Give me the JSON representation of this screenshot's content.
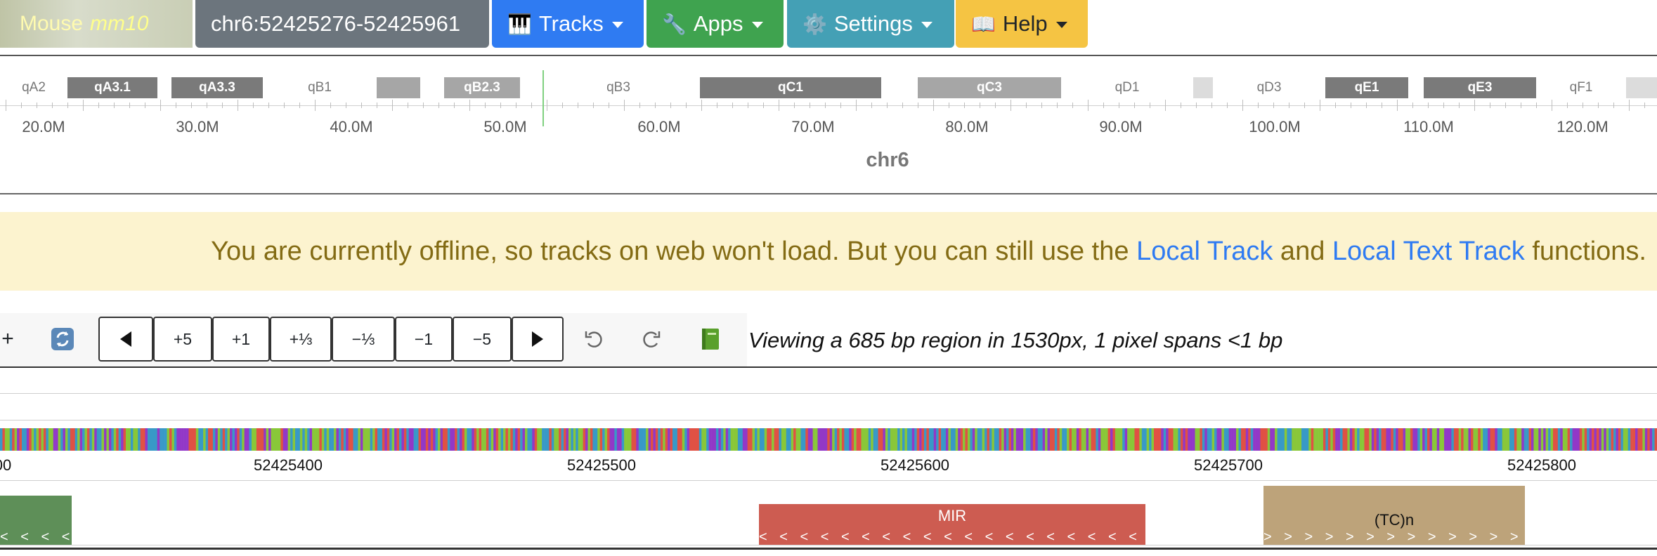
{
  "navbar": {
    "species": "Mouse",
    "assembly": "mm10",
    "region": "chr6:52425276-52425961",
    "tracks": "Tracks",
    "apps": "Apps",
    "settings": "Settings",
    "help": "Help",
    "tracks_icon": "🎹",
    "apps_icon": "🔧",
    "settings_icon": "⚙️",
    "help_icon": "📖"
  },
  "ideogram": {
    "chromosome": "chr6",
    "bands": [
      {
        "name": "qA2",
        "stain": "white"
      },
      {
        "name": "qA3.1",
        "stain": "dark"
      },
      {
        "name": "",
        "stain": "white"
      },
      {
        "name": "qA3.3",
        "stain": "dark"
      },
      {
        "name": "qB1",
        "stain": "white"
      },
      {
        "name": "",
        "stain": "mid"
      },
      {
        "name": "",
        "stain": "white"
      },
      {
        "name": "qB2.3",
        "stain": "mid"
      },
      {
        "name": "",
        "stain": "white"
      },
      {
        "name": "qB3",
        "stain": "white"
      },
      {
        "name": "qC1",
        "stain": "dark"
      },
      {
        "name": "",
        "stain": "white"
      },
      {
        "name": "qC3",
        "stain": "mid"
      },
      {
        "name": "qD1",
        "stain": "white"
      },
      {
        "name": "",
        "stain": "light"
      },
      {
        "name": "qD3",
        "stain": "white"
      },
      {
        "name": "qE1",
        "stain": "dark"
      },
      {
        "name": "",
        "stain": "white"
      },
      {
        "name": "qE3",
        "stain": "dark"
      },
      {
        "name": "qF1",
        "stain": "white"
      },
      {
        "name": "",
        "stain": "light"
      }
    ],
    "ruler_labels": [
      "20.0M",
      "30.0M",
      "40.0M",
      "50.0M",
      "60.0M",
      "70.0M",
      "80.0M",
      "90.0M",
      "100.0M",
      "110.0M",
      "120.0M"
    ]
  },
  "alert": {
    "text1": "You are currently offline, so tracks on web won't load. But you can still use the ",
    "link1": "Local Track",
    "text2": " and ",
    "link2": "Local Text Track",
    "text3": " functions."
  },
  "toolbar": {
    "add": "+",
    "zoom_in_5": "+5",
    "zoom_in_1": "+1",
    "zoom_in_third": "+⅓",
    "zoom_out_third": "−⅓",
    "zoom_out_1": "−1",
    "zoom_out_5": "−5",
    "view_info": "Viewing a 685 bp region in 1530px, 1 pixel spans <1 bp"
  },
  "genome": {
    "coordinates": [
      "00",
      "52425400",
      "52425500",
      "52425600",
      "52425700",
      "52425800"
    ],
    "features": [
      {
        "label": "",
        "color": "#5e8f58",
        "strand": "<"
      },
      {
        "label": "MIR",
        "color": "#cd5c51",
        "strand": "<"
      },
      {
        "label": "(TC)n",
        "color": "#bda37a",
        "strand": ">"
      }
    ],
    "base_colors": {
      "A": "#89c738",
      "C": "#3899c7",
      "G": "#e05144",
      "T": "#9238c7"
    }
  }
}
